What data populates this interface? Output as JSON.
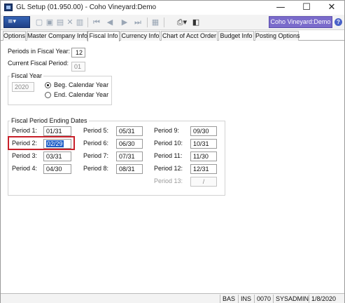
{
  "window": {
    "title": "GL Setup (01.950.00) - Coho Vineyard:Demo",
    "controls": {
      "minimize": "—",
      "maximize": "☐",
      "close": "✕"
    }
  },
  "toolbar": {
    "menu_glyph": "≡▾",
    "company": "Coho Vineyard:Demo",
    "help": "?"
  },
  "tabs": [
    "Options",
    "Master Company Info",
    "Fiscal Info",
    "Currency Info",
    "Chart of Acct Order",
    "Budget Info",
    "Posting Options"
  ],
  "fiscal": {
    "periods_label": "Periods in Fiscal Year:",
    "periods_value": "12",
    "current_label": "Current Fiscal Period:",
    "current_value": "01",
    "year_group": "Fiscal Year",
    "year_value": "2020",
    "opt_beg": "Beg. Calendar Year",
    "opt_end": "End. Calendar Year",
    "selected_option": "beg"
  },
  "ending": {
    "group": "Fiscal Period Ending Dates",
    "periods": [
      {
        "label": "Period  1:",
        "value": "01/31"
      },
      {
        "label": "Period  2:",
        "value": "02/29"
      },
      {
        "label": "Period  3:",
        "value": "03/31"
      },
      {
        "label": "Period  4:",
        "value": "04/30"
      },
      {
        "label": "Period  5:",
        "value": "05/31"
      },
      {
        "label": "Period  6:",
        "value": "06/30"
      },
      {
        "label": "Period  7:",
        "value": "07/31"
      },
      {
        "label": "Period  8:",
        "value": "08/31"
      },
      {
        "label": "Period  9:",
        "value": "09/30"
      },
      {
        "label": "Period  10:",
        "value": "10/31"
      },
      {
        "label": "Period  11:",
        "value": "11/30"
      },
      {
        "label": "Period  12:",
        "value": "12/31"
      },
      {
        "label": "Period  13:",
        "value": "/"
      }
    ]
  },
  "status": [
    "BAS",
    "INS",
    "0070",
    "SYSADMIN",
    "1/8/2020"
  ],
  "colors": {
    "accent": "#7a6bcb",
    "highlight": "#c8202a",
    "selection": "#1f5fc7"
  }
}
